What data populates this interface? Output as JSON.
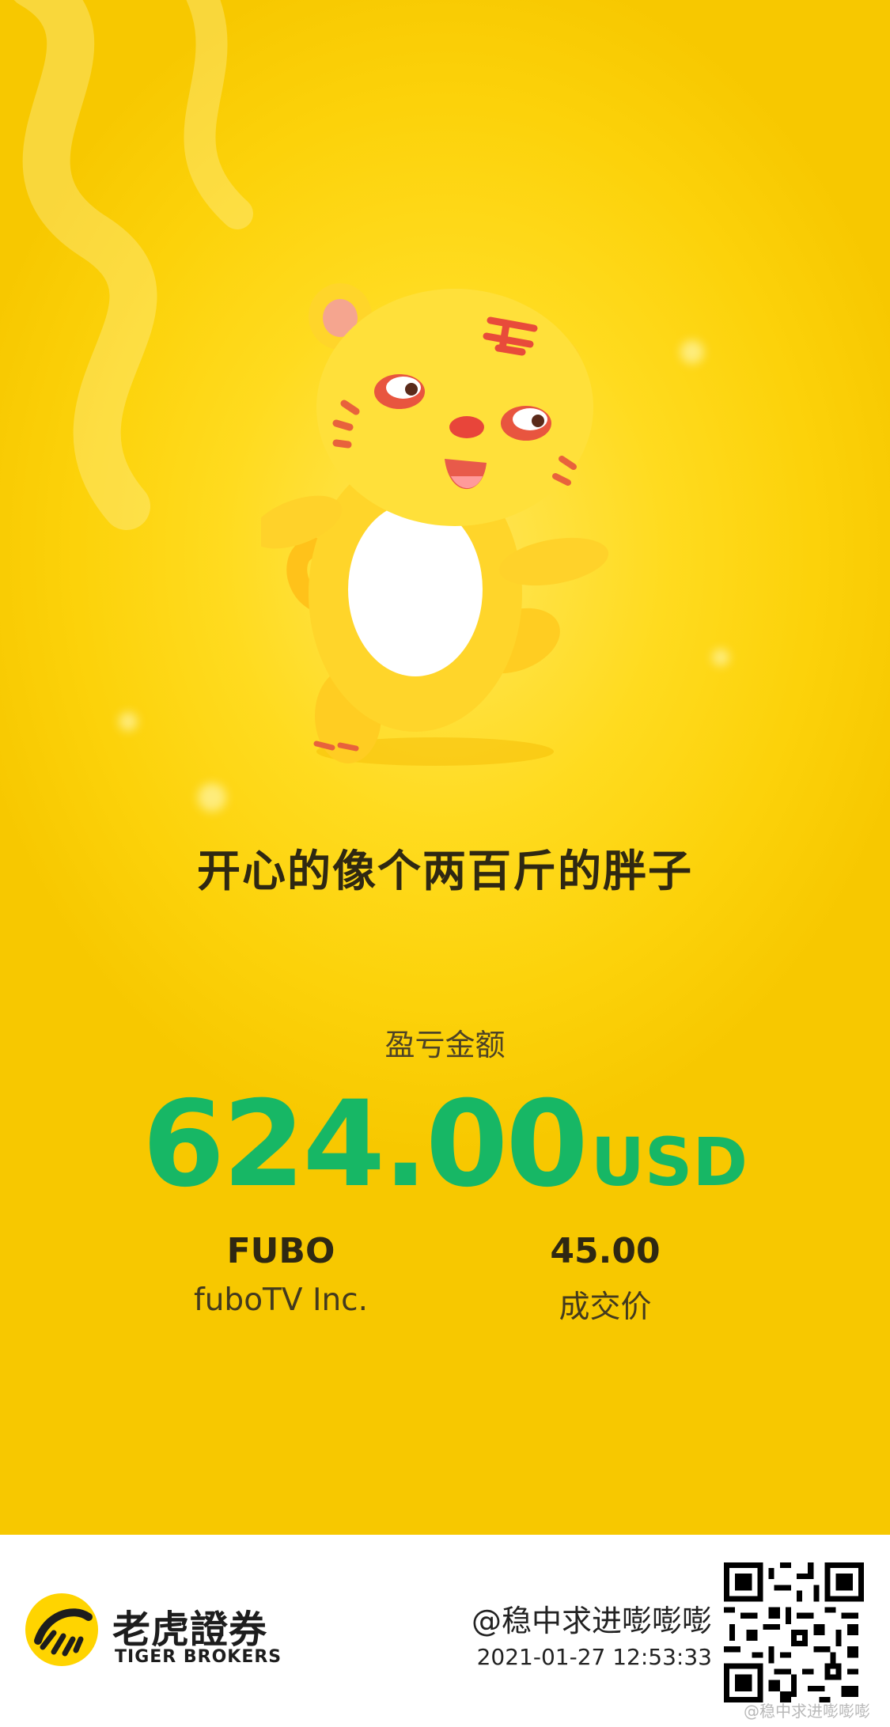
{
  "card": {
    "slogan": "开心的像个两百斤的胖子",
    "pnl_label": "盈亏金额",
    "pnl_amount": "624.00",
    "pnl_currency": "USD",
    "symbol": "FUBO",
    "company": "fuboTV Inc.",
    "price": "45.00",
    "price_label": "成交价",
    "mascot_icon": "tiger-mascot-icon"
  },
  "footer": {
    "brand_cn": "老虎證券",
    "brand_en": "TIGER BROKERS",
    "user": "@稳中求进嘭嘭嘭",
    "timestamp": "2021-01-27 12:53:33",
    "qr_icon": "qr-code-icon",
    "watermark": "@稳中求进嘭嘭嘭"
  },
  "colors": {
    "background": "#ffd814",
    "pnl_green": "#17b765",
    "text_dark": "#2f2812"
  }
}
